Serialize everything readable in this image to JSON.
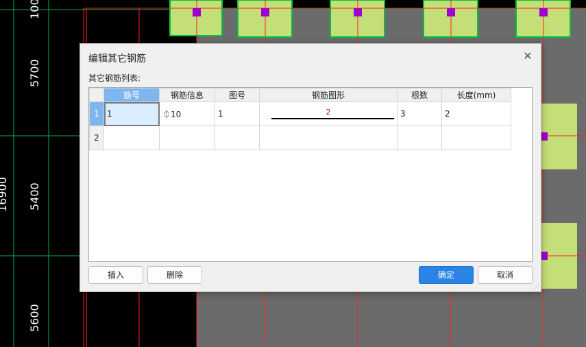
{
  "background": {
    "dimension_labels": [
      "100",
      "5700",
      "5400",
      "16900",
      "5600"
    ],
    "colors": {
      "canvas": "#000000",
      "axis_line": "#ff2020",
      "dim_line": "#00b050",
      "column_fill": "#c5df78",
      "node_marker": "#a000d0",
      "slab": "#6b6b6b"
    }
  },
  "dialog": {
    "title": "编辑其它钢筋",
    "close_icon": "close-icon",
    "list_label": "其它钢筋列表:",
    "grid": {
      "columns": [
        "筋号",
        "钢筋信息",
        "图号",
        "钢筋图形",
        "根数",
        "长度(mm)"
      ],
      "rows": [
        {
          "index": "1",
          "bar_no": "1",
          "bar_info": "⏀10",
          "fig_no": "1",
          "shape_value": "2",
          "count": "3",
          "length": "2"
        },
        {
          "index": "2",
          "bar_no": "",
          "bar_info": "",
          "fig_no": "",
          "shape_value": "",
          "count": "",
          "length": ""
        }
      ]
    },
    "buttons": {
      "insert": "插入",
      "delete": "删除",
      "ok": "确定",
      "cancel": "取消"
    },
    "colors": {
      "selected_header": "#7fb6ee",
      "active_cell": "#dbeeff",
      "primary_button": "#2a84e6",
      "shape_number": "#c0152a"
    }
  }
}
